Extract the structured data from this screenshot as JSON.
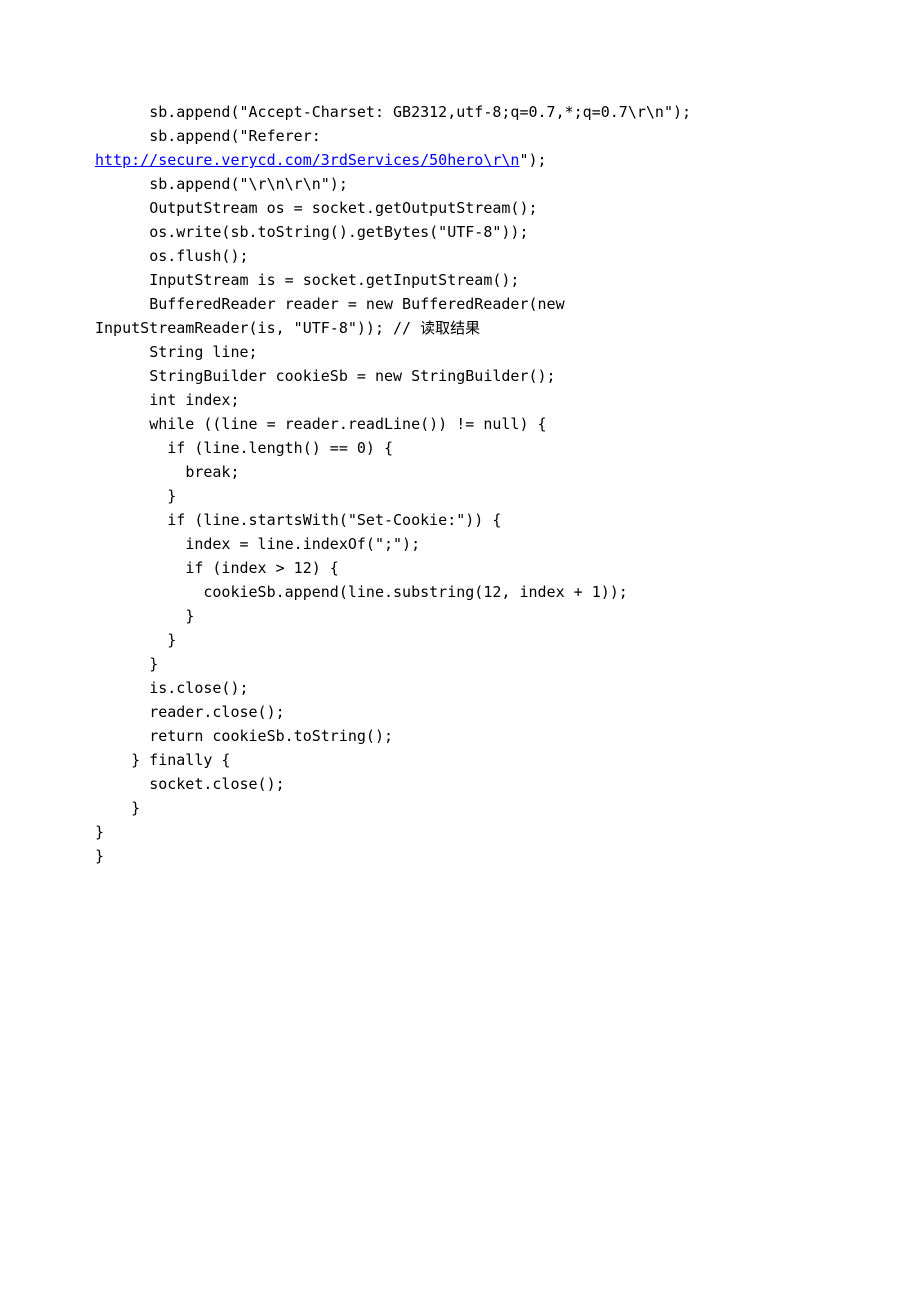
{
  "lines": [
    {
      "indent": "      ",
      "pre": "sb.append(\"Accept-Charset: GB2312,utf-8;q=0.7,*;q=0.7\\r\\n\");",
      "link": "",
      "post": ""
    },
    {
      "indent": "      ",
      "pre": "sb.append(\"Referer: ",
      "link": "",
      "post": ""
    },
    {
      "indent": "",
      "pre": "",
      "link": "http://secure.verycd.com/3rdServices/50hero\\r\\n",
      "post": "\");"
    },
    {
      "indent": "      ",
      "pre": "sb.append(\"\\r\\n\\r\\n\");",
      "link": "",
      "post": ""
    },
    {
      "indent": "      ",
      "pre": "OutputStream os = socket.getOutputStream();",
      "link": "",
      "post": ""
    },
    {
      "indent": "      ",
      "pre": "os.write(sb.toString().getBytes(\"UTF-8\"));",
      "link": "",
      "post": ""
    },
    {
      "indent": "      ",
      "pre": "os.flush();",
      "link": "",
      "post": ""
    },
    {
      "indent": "      ",
      "pre": "InputStream is = socket.getInputStream();",
      "link": "",
      "post": ""
    },
    {
      "indent": "      ",
      "pre": "BufferedReader reader = new BufferedReader(new ",
      "link": "",
      "post": ""
    },
    {
      "indent": "",
      "pre": "InputStreamReader(is, \"UTF-8\")); // 读取结果",
      "link": "",
      "post": ""
    },
    {
      "indent": "      ",
      "pre": "String line;",
      "link": "",
      "post": ""
    },
    {
      "indent": "      ",
      "pre": "StringBuilder cookieSb = new StringBuilder();",
      "link": "",
      "post": ""
    },
    {
      "indent": "      ",
      "pre": "int index;",
      "link": "",
      "post": ""
    },
    {
      "indent": "      ",
      "pre": "while ((line = reader.readLine()) != null) {",
      "link": "",
      "post": ""
    },
    {
      "indent": "        ",
      "pre": "if (line.length() == 0) {",
      "link": "",
      "post": ""
    },
    {
      "indent": "          ",
      "pre": "break;",
      "link": "",
      "post": ""
    },
    {
      "indent": "        ",
      "pre": "}",
      "link": "",
      "post": ""
    },
    {
      "indent": "        ",
      "pre": "if (line.startsWith(\"Set-Cookie:\")) {",
      "link": "",
      "post": ""
    },
    {
      "indent": "          ",
      "pre": "index = line.indexOf(\";\");",
      "link": "",
      "post": ""
    },
    {
      "indent": "          ",
      "pre": "if (index > 12) {",
      "link": "",
      "post": ""
    },
    {
      "indent": "            ",
      "pre": "cookieSb.append(line.substring(12, index + 1));",
      "link": "",
      "post": ""
    },
    {
      "indent": "          ",
      "pre": "}",
      "link": "",
      "post": ""
    },
    {
      "indent": "        ",
      "pre": "}",
      "link": "",
      "post": ""
    },
    {
      "indent": "      ",
      "pre": "}",
      "link": "",
      "post": ""
    },
    {
      "indent": "      ",
      "pre": "is.close();",
      "link": "",
      "post": ""
    },
    {
      "indent": "      ",
      "pre": "reader.close();",
      "link": "",
      "post": ""
    },
    {
      "indent": "      ",
      "pre": "return cookieSb.toString();",
      "link": "",
      "post": ""
    },
    {
      "indent": "    ",
      "pre": "} finally {",
      "link": "",
      "post": ""
    },
    {
      "indent": "      ",
      "pre": "socket.close();",
      "link": "",
      "post": ""
    },
    {
      "indent": "    ",
      "pre": "}",
      "link": "",
      "post": ""
    },
    {
      "indent": "",
      "pre": "}",
      "link": "",
      "post": ""
    },
    {
      "indent": "",
      "pre": "}",
      "link": "",
      "post": ""
    }
  ]
}
